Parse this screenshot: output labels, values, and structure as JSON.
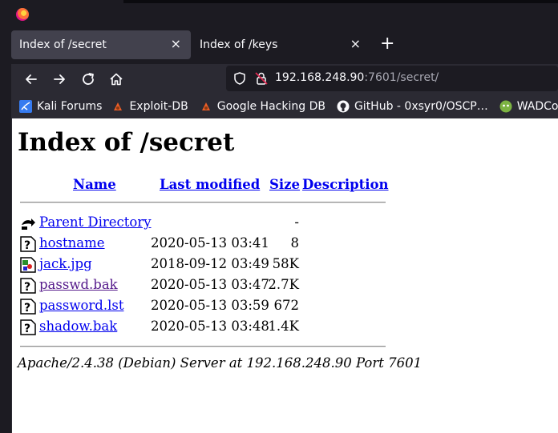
{
  "tabs": [
    {
      "label": "Index of /secret",
      "active": true
    },
    {
      "label": "Index of /keys",
      "active": false
    }
  ],
  "tab_close_glyph": "×",
  "new_tab_glyph": "+",
  "url": {
    "host": "192.168.248.90",
    "rest": ":7601/secret/"
  },
  "bookmarks": [
    {
      "label": "Kali Forums",
      "icon": "kali-dragon-icon"
    },
    {
      "label": "Exploit-DB",
      "icon": "exploit-db-icon"
    },
    {
      "label": "Google Hacking DB",
      "icon": "ghdb-icon"
    },
    {
      "label": "GitHub - 0xsyr0/OSCP…",
      "icon": "github-icon"
    },
    {
      "label": "WADComs",
      "icon": "wadcoms-icon"
    }
  ],
  "page": {
    "title": "Index of /secret",
    "headers": {
      "name": "Name",
      "modified": "Last modified",
      "size": "Size",
      "description": "Description"
    },
    "parent": {
      "label": "Parent Directory",
      "size": "-"
    },
    "files": [
      {
        "name": "hostname",
        "modified": "2020-05-13 03:41",
        "size": "8",
        "icon": "unknown-file-icon",
        "visited": false
      },
      {
        "name": "jack.jpg",
        "modified": "2018-09-12 03:49",
        "size": "58K",
        "icon": "image-file-icon",
        "visited": false
      },
      {
        "name": "passwd.bak",
        "modified": "2020-05-13 03:47",
        "size": "2.7K",
        "icon": "unknown-file-icon",
        "visited": true
      },
      {
        "name": "password.lst",
        "modified": "2020-05-13 03:59",
        "size": "672",
        "icon": "unknown-file-icon",
        "visited": false
      },
      {
        "name": "shadow.bak",
        "modified": "2020-05-13 03:48",
        "size": "1.4K",
        "icon": "unknown-file-icon",
        "visited": false
      }
    ],
    "footer": "Apache/2.4.38 (Debian) Server at 192.168.248.90 Port 7601"
  }
}
